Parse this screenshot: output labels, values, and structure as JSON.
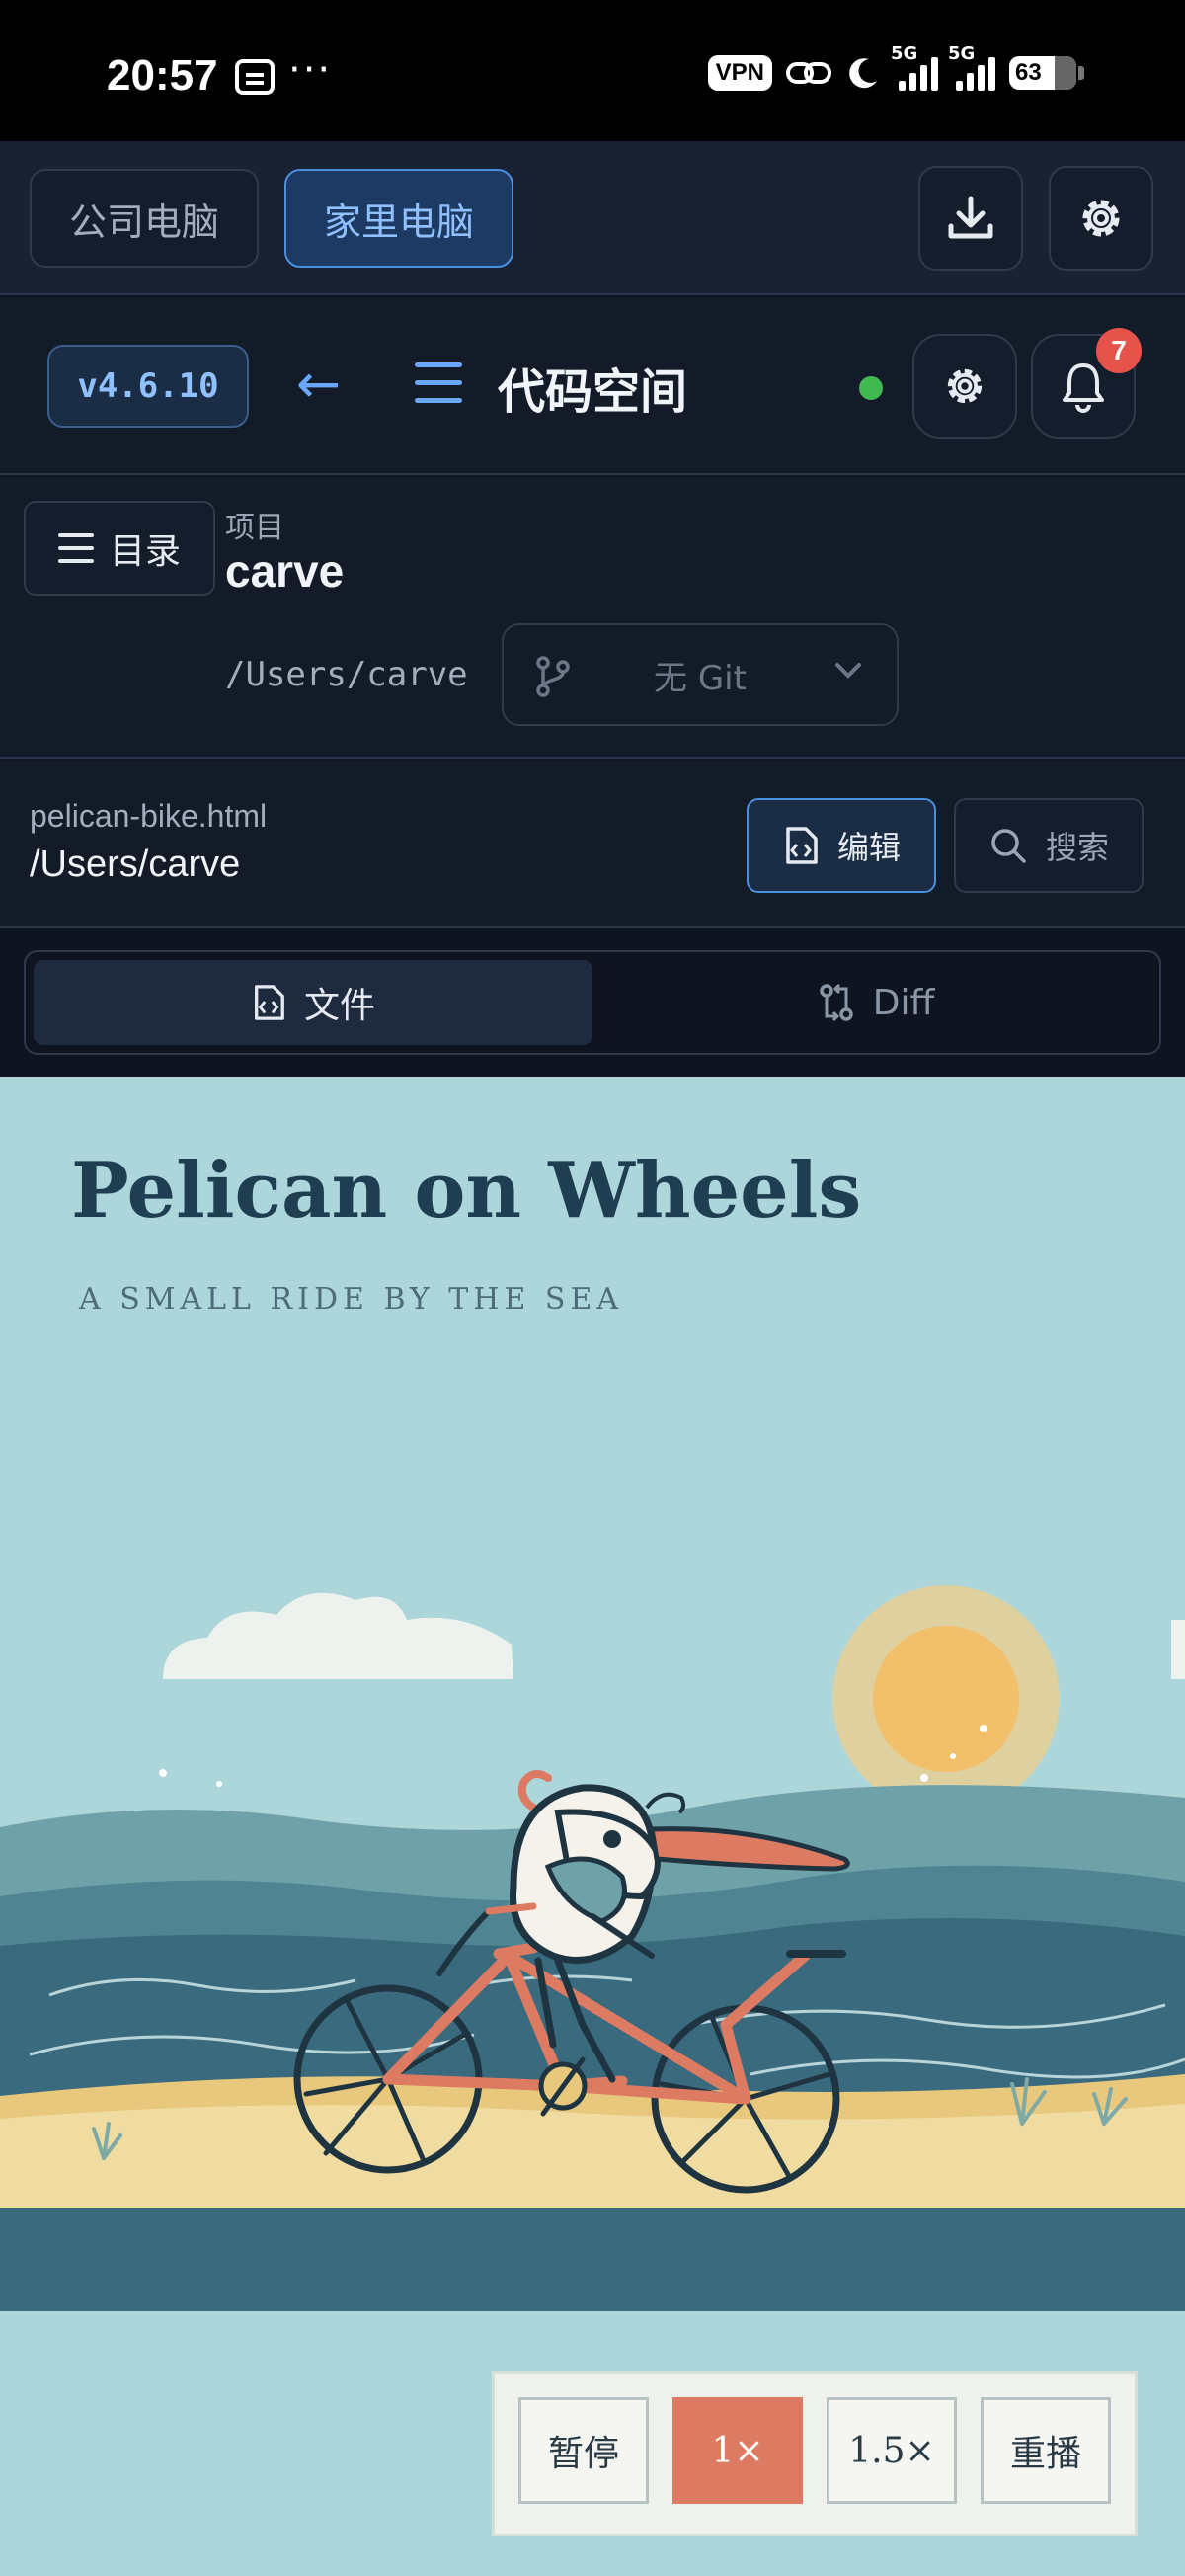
{
  "status_bar": {
    "time": "20:57",
    "dots": "···",
    "vpn": "VPN",
    "network1": "5G",
    "network2": "5G",
    "battery": "63"
  },
  "machines": {
    "office": "公司电脑",
    "home": "家里电脑"
  },
  "header": {
    "version": "v4.6.10",
    "back": "←",
    "title": "代码空间",
    "notifications": "7"
  },
  "project": {
    "toc_label": "目录",
    "label": "项目",
    "name": "carve",
    "path": "/Users/carve",
    "git": "无 Git"
  },
  "file": {
    "name": "pelican-bike.html",
    "path": "/Users/carve",
    "edit": "编辑",
    "search": "搜索"
  },
  "tabs": {
    "file": "文件",
    "diff": "Diff"
  },
  "preview": {
    "title": "Pelican on Wheels",
    "subtitle": "A SMALL RIDE BY THE SEA",
    "controls": [
      "暂停",
      "1×",
      "1.5×",
      "重播"
    ],
    "active_control": "1×",
    "colors": {
      "sky": "#add6da",
      "sea": "#3a6a7e",
      "sand": "#f0dca0",
      "bike": "#dc7a62",
      "sun": "#f2c06a"
    }
  }
}
